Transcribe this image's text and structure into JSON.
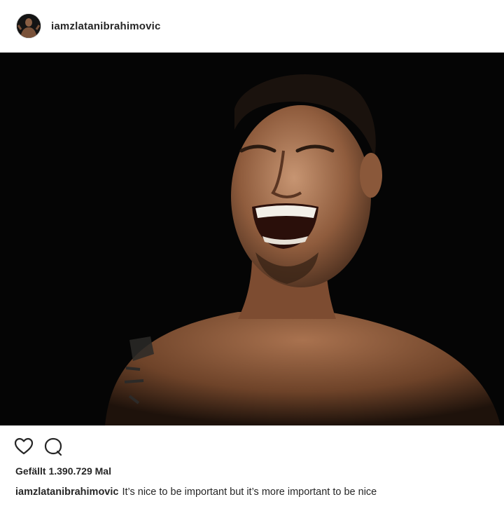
{
  "post": {
    "username": "iamzlatanibrahimovic",
    "photo_alt": "Smiling man portrait",
    "likes_text": "Gefällt 1.390.729 Mal",
    "caption_user": "iamzlatanibrahimovic",
    "caption_text": "It’s nice to be important but it’s more important to be nice"
  },
  "icons": {
    "like": "heart-icon",
    "comment": "comment-icon"
  },
  "colors": {
    "text": "#262626",
    "photo_background": "#050505",
    "divider": "#efefef"
  }
}
